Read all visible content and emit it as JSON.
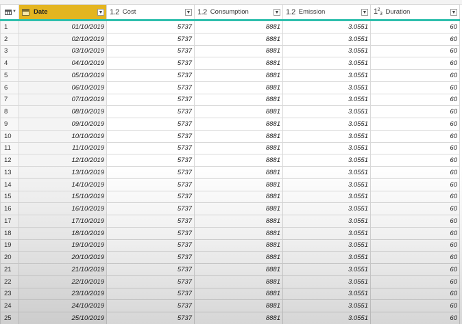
{
  "columns": [
    {
      "type_icon": "calendar-icon",
      "label": "Date",
      "selected": true
    },
    {
      "type_icon": "1.2",
      "label": "Cost",
      "selected": false
    },
    {
      "type_icon": "1.2",
      "label": "Consumption",
      "selected": false
    },
    {
      "type_icon": "1.2",
      "label": "Emission",
      "selected": false
    },
    {
      "type_icon": "123",
      "label": "Duration",
      "selected": false
    }
  ],
  "rows": [
    {
      "n": "1",
      "date": "01/10/2019",
      "cost": "5737",
      "consumption": "8881",
      "emission": "3.0551",
      "duration": "60"
    },
    {
      "n": "2",
      "date": "02/10/2019",
      "cost": "5737",
      "consumption": "8881",
      "emission": "3.0551",
      "duration": "60"
    },
    {
      "n": "3",
      "date": "03/10/2019",
      "cost": "5737",
      "consumption": "8881",
      "emission": "3.0551",
      "duration": "60"
    },
    {
      "n": "4",
      "date": "04/10/2019",
      "cost": "5737",
      "consumption": "8881",
      "emission": "3.0551",
      "duration": "60"
    },
    {
      "n": "5",
      "date": "05/10/2019",
      "cost": "5737",
      "consumption": "8881",
      "emission": "3.0551",
      "duration": "60"
    },
    {
      "n": "6",
      "date": "06/10/2019",
      "cost": "5737",
      "consumption": "8881",
      "emission": "3.0551",
      "duration": "60"
    },
    {
      "n": "7",
      "date": "07/10/2019",
      "cost": "5737",
      "consumption": "8881",
      "emission": "3.0551",
      "duration": "60"
    },
    {
      "n": "8",
      "date": "08/10/2019",
      "cost": "5737",
      "consumption": "8881",
      "emission": "3.0551",
      "duration": "60"
    },
    {
      "n": "9",
      "date": "09/10/2019",
      "cost": "5737",
      "consumption": "8881",
      "emission": "3.0551",
      "duration": "60"
    },
    {
      "n": "10",
      "date": "10/10/2019",
      "cost": "5737",
      "consumption": "8881",
      "emission": "3.0551",
      "duration": "60"
    },
    {
      "n": "11",
      "date": "11/10/2019",
      "cost": "5737",
      "consumption": "8881",
      "emission": "3.0551",
      "duration": "60"
    },
    {
      "n": "12",
      "date": "12/10/2019",
      "cost": "5737",
      "consumption": "8881",
      "emission": "3.0551",
      "duration": "60"
    },
    {
      "n": "13",
      "date": "13/10/2019",
      "cost": "5737",
      "consumption": "8881",
      "emission": "3.0551",
      "duration": "60"
    },
    {
      "n": "14",
      "date": "14/10/2019",
      "cost": "5737",
      "consumption": "8881",
      "emission": "3.0551",
      "duration": "60"
    },
    {
      "n": "15",
      "date": "15/10/2019",
      "cost": "5737",
      "consumption": "8881",
      "emission": "3.0551",
      "duration": "60"
    },
    {
      "n": "16",
      "date": "16/10/2019",
      "cost": "5737",
      "consumption": "8881",
      "emission": "3.0551",
      "duration": "60"
    },
    {
      "n": "17",
      "date": "17/10/2019",
      "cost": "5737",
      "consumption": "8881",
      "emission": "3.0551",
      "duration": "60"
    },
    {
      "n": "18",
      "date": "18/10/2019",
      "cost": "5737",
      "consumption": "8881",
      "emission": "3.0551",
      "duration": "60"
    },
    {
      "n": "19",
      "date": "19/10/2019",
      "cost": "5737",
      "consumption": "8881",
      "emission": "3.0551",
      "duration": "60"
    },
    {
      "n": "20",
      "date": "20/10/2019",
      "cost": "5737",
      "consumption": "8881",
      "emission": "3.0551",
      "duration": "60"
    },
    {
      "n": "21",
      "date": "21/10/2019",
      "cost": "5737",
      "consumption": "8881",
      "emission": "3.0551",
      "duration": "60"
    },
    {
      "n": "22",
      "date": "22/10/2019",
      "cost": "5737",
      "consumption": "8881",
      "emission": "3.0551",
      "duration": "60"
    },
    {
      "n": "23",
      "date": "23/10/2019",
      "cost": "5737",
      "consumption": "8881",
      "emission": "3.0551",
      "duration": "60"
    },
    {
      "n": "24",
      "date": "24/10/2019",
      "cost": "5737",
      "consumption": "8881",
      "emission": "3.0551",
      "duration": "60"
    },
    {
      "n": "25",
      "date": "25/10/2019",
      "cost": "5737",
      "consumption": "8881",
      "emission": "3.0551",
      "duration": "60"
    }
  ],
  "colors": {
    "selected_header": "#e4b520",
    "header_underline": "#2fbfad",
    "grid_line": "#d9d9d9"
  }
}
